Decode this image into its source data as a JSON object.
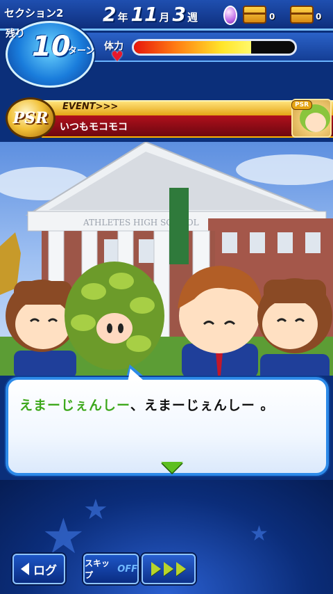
{
  "header": {
    "section_label": "セクション2",
    "remaining_label": "残り",
    "turns_remaining": "10",
    "turn_unit": "ターン",
    "date": {
      "year": "2",
      "year_unit": "年",
      "month": "11",
      "month_unit": "月",
      "week": "3",
      "week_unit": "週"
    },
    "items": {
      "gem_icon": "purple-gem-icon",
      "red_chest_count": "0",
      "gold_chest_count": "0"
    },
    "stamina": {
      "label": "体力",
      "level": 0.73
    }
  },
  "event": {
    "tag": "EVENT>>>",
    "title": "いつもモコモコ",
    "badge": "PSR",
    "portrait_badge": "PSR"
  },
  "scene": {
    "description_icon": "school-building-scene",
    "banner_text": "ATHLETES HIGH SCHOOL"
  },
  "dialog": {
    "speaker_text": "えまーじぇんしー",
    "rest_text": "、えまーじぇんしー 。",
    "next_icon": "next-arrow-icon"
  },
  "controls": {
    "log_label": "ログ",
    "skip_label": "スキップ",
    "skip_state": "OFF",
    "fast_forward_icon": "fast-forward-icon"
  },
  "colors": {
    "accent_blue": "#2d8ae8",
    "speaker_green": "#3da81b",
    "event_red": "#b0101c",
    "event_gold": "#e4a415"
  }
}
